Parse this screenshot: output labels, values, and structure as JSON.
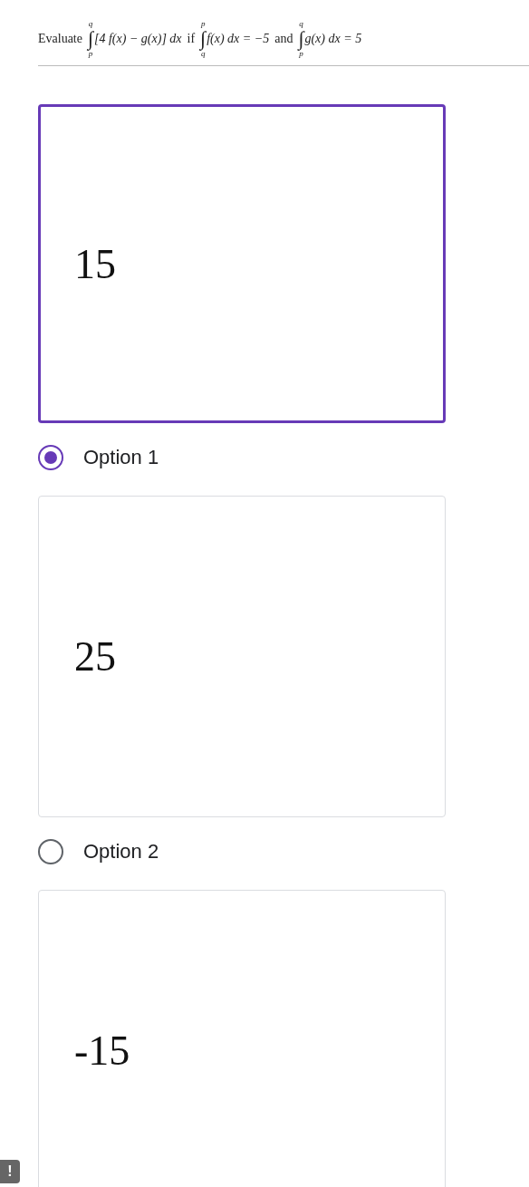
{
  "question": [
    {
      "kind": "text",
      "text": "Evaluate"
    },
    {
      "kind": "integral",
      "sign": "∫",
      "upper": "q",
      "lower": "p",
      "body": "[4 f(x) − g(x)] dx"
    },
    {
      "kind": "text",
      "text": "if"
    },
    {
      "kind": "integral",
      "sign": "∫",
      "upper": "p",
      "lower": "q",
      "body": "f(x) dx = −5"
    },
    {
      "kind": "text",
      "text": "and"
    },
    {
      "kind": "integral",
      "sign": "∫",
      "upper": "q",
      "lower": "p",
      "body": "g(x) dx = 5"
    }
  ],
  "options": [
    {
      "answer": "15",
      "label": "Option 1",
      "selected": true
    },
    {
      "answer": "25",
      "label": "Option 2",
      "selected": false
    },
    {
      "answer": "-15",
      "selected": false
    }
  ],
  "feedback_badge": "!"
}
